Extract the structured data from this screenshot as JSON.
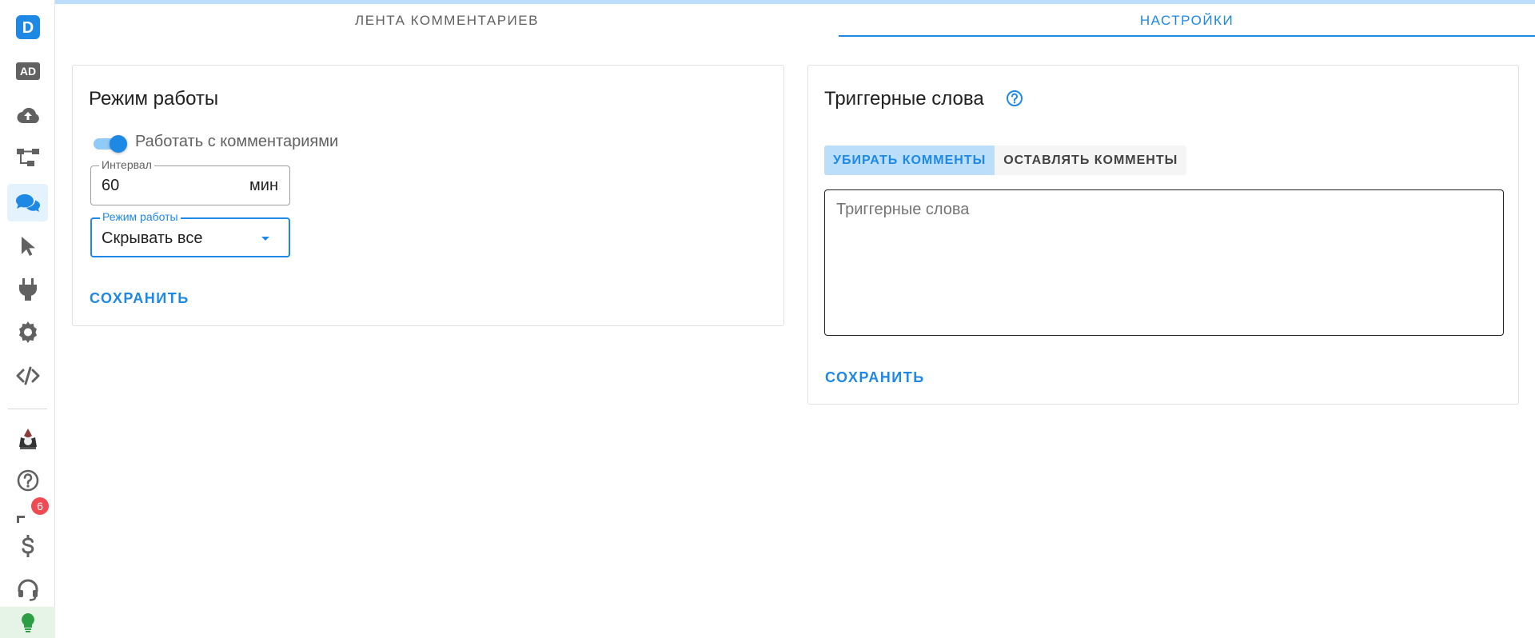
{
  "sidebar": {
    "items": [
      {
        "name": "logo-icon",
        "icon": "D"
      },
      {
        "name": "ad-icon",
        "icon": "AD"
      },
      {
        "name": "cloud-upload-icon"
      },
      {
        "name": "sitemap-icon"
      },
      {
        "name": "comments-icon",
        "active": true
      },
      {
        "name": "cursor-icon"
      },
      {
        "name": "plug-icon"
      },
      {
        "name": "gear-icon"
      },
      {
        "name": "code-icon"
      },
      {
        "name": "avatar"
      },
      {
        "name": "help-circle-icon"
      },
      {
        "name": "notifications-icon",
        "badge": "6"
      },
      {
        "name": "dollar-icon"
      },
      {
        "name": "headset-icon"
      },
      {
        "name": "lightbulb-icon"
      }
    ],
    "badge_count": "6",
    "logo_letter": "D",
    "ad_label": "AD"
  },
  "tabs": [
    {
      "label": "Лента комментариев",
      "active": false
    },
    {
      "label": "Настройки",
      "active": true
    }
  ],
  "work_mode": {
    "title": "Режим работы",
    "switch_label": "Работать с комментариями",
    "switch_on": true,
    "interval_label": "Интервал",
    "interval_value": "60",
    "interval_suffix": "мин",
    "mode_label": "Режим работы",
    "mode_value": "Скрывать все",
    "save_label": "Сохранить"
  },
  "trigger_words": {
    "title": "Триггерные слова",
    "toggle_options": [
      "Убирать комменты",
      "Оставлять комменты"
    ],
    "toggle_active": 0,
    "textarea_placeholder": "Триггерные слова",
    "save_label": "Сохранить"
  },
  "colors": {
    "accent": "#1e88e5",
    "accent_light": "#bbdefb",
    "badge": "#f04a52",
    "icon_gray": "#616161"
  }
}
